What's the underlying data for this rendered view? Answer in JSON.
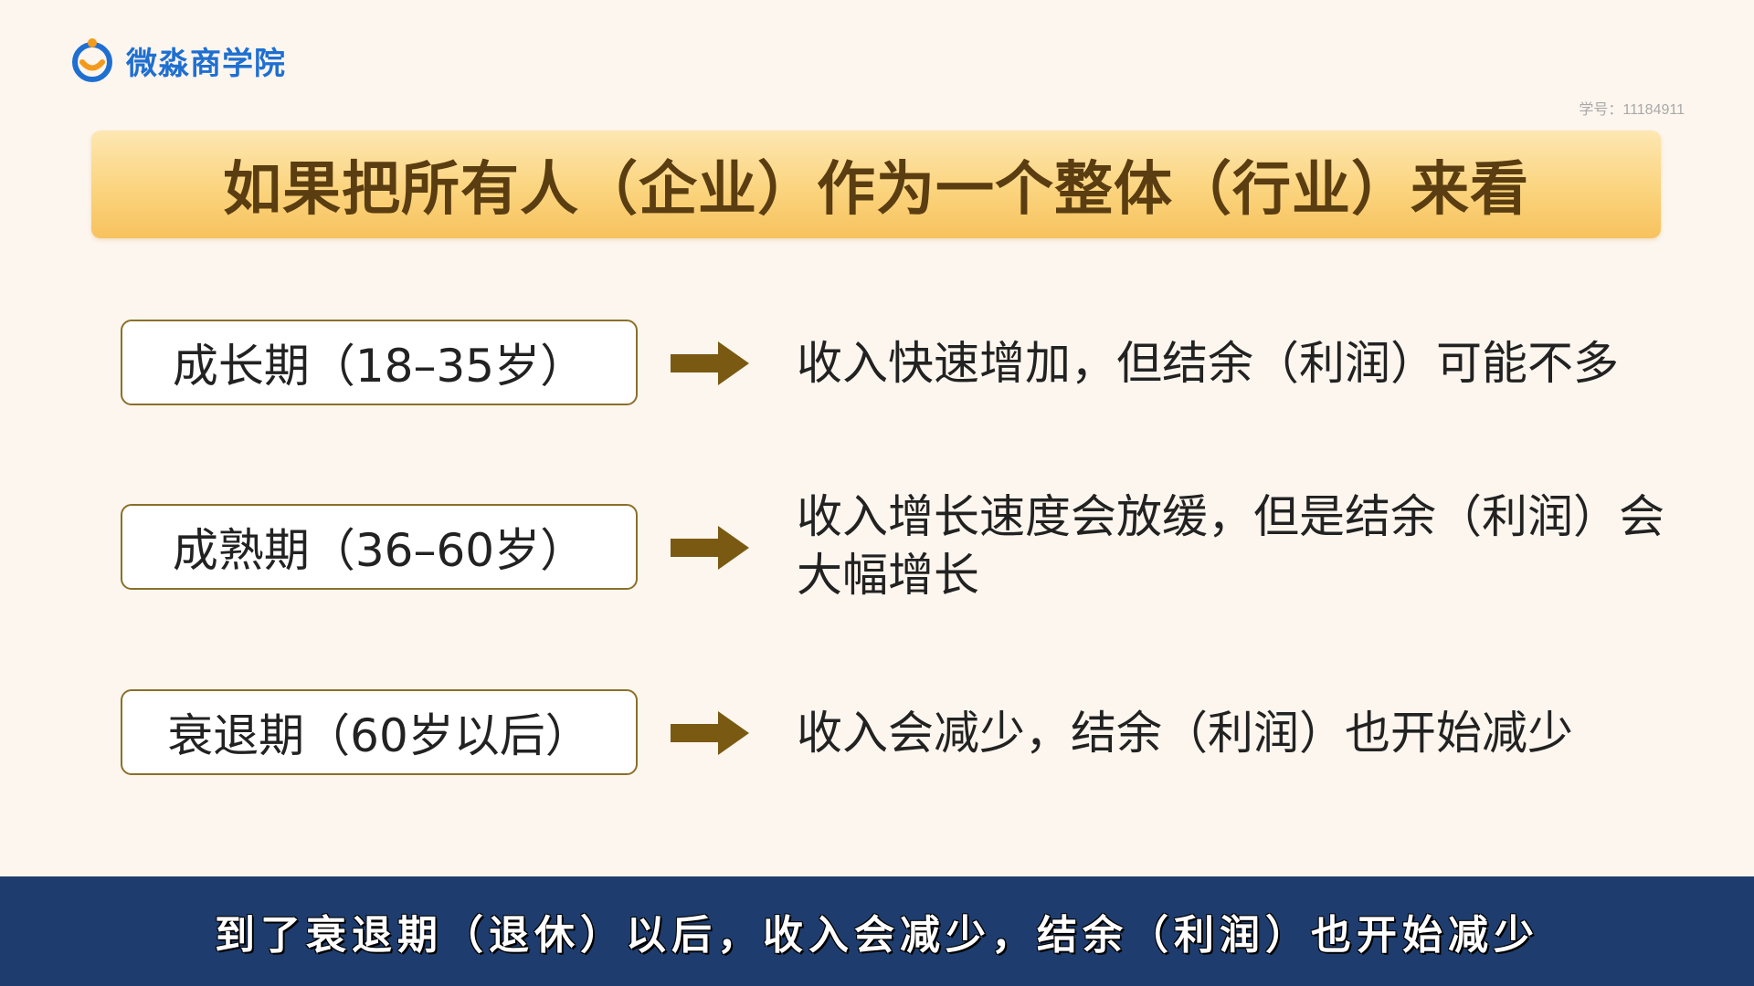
{
  "brand": {
    "name": "微淼商学院",
    "logo_icon": "smile-ring-logo-icon"
  },
  "student_id": "学号：11184911",
  "title": "如果把所有人（企业）作为一个整体（行业）来看",
  "stages": [
    {
      "label": "成长期（18–35岁）",
      "description": "收入快速增加，但结余（利润）可能不多"
    },
    {
      "label": "成熟期（36–60岁）",
      "description": "收入增长速度会放缓，但是结余（利润）会大幅增长"
    },
    {
      "label": "衰退期（60岁以后）",
      "description": "收入会减少，结余（利润）也开始减少"
    }
  ],
  "subtitle": "到了衰退期（退休）以后，收入会减少，结余（利润）也开始减少",
  "colors": {
    "background": "#fdf6ee",
    "title_bar": "#fbd47e",
    "title_text": "#5a3d10",
    "box_border": "#8b6f2a",
    "arrow": "#7a5a12",
    "subtitle_band": "#1e3d6e",
    "brand": "#1f6fd1"
  }
}
